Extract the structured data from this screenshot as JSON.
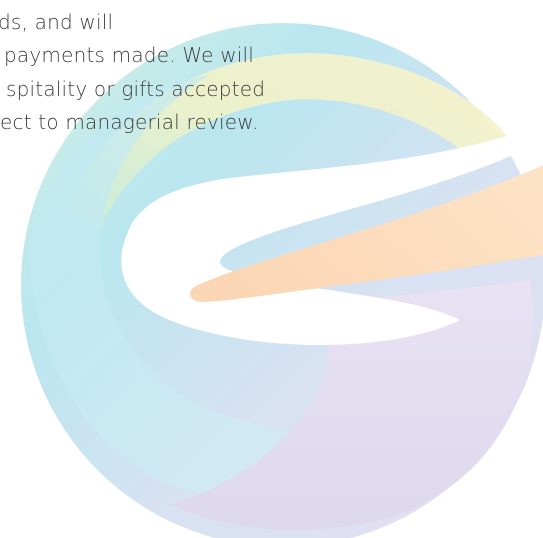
{
  "document": {
    "lines": [
      "ds, and will",
      " payments made. We will",
      "spitality or gifts accepted",
      "ect to managerial review."
    ]
  },
  "watermark": {
    "icon": "swirl-logo-icon",
    "colors": {
      "cyan": "#a8e0ee",
      "mint": "#cdeedd",
      "yellow": "#f6f2c2",
      "orange": "#fbd9b6",
      "violet": "#e3dcf0"
    }
  }
}
